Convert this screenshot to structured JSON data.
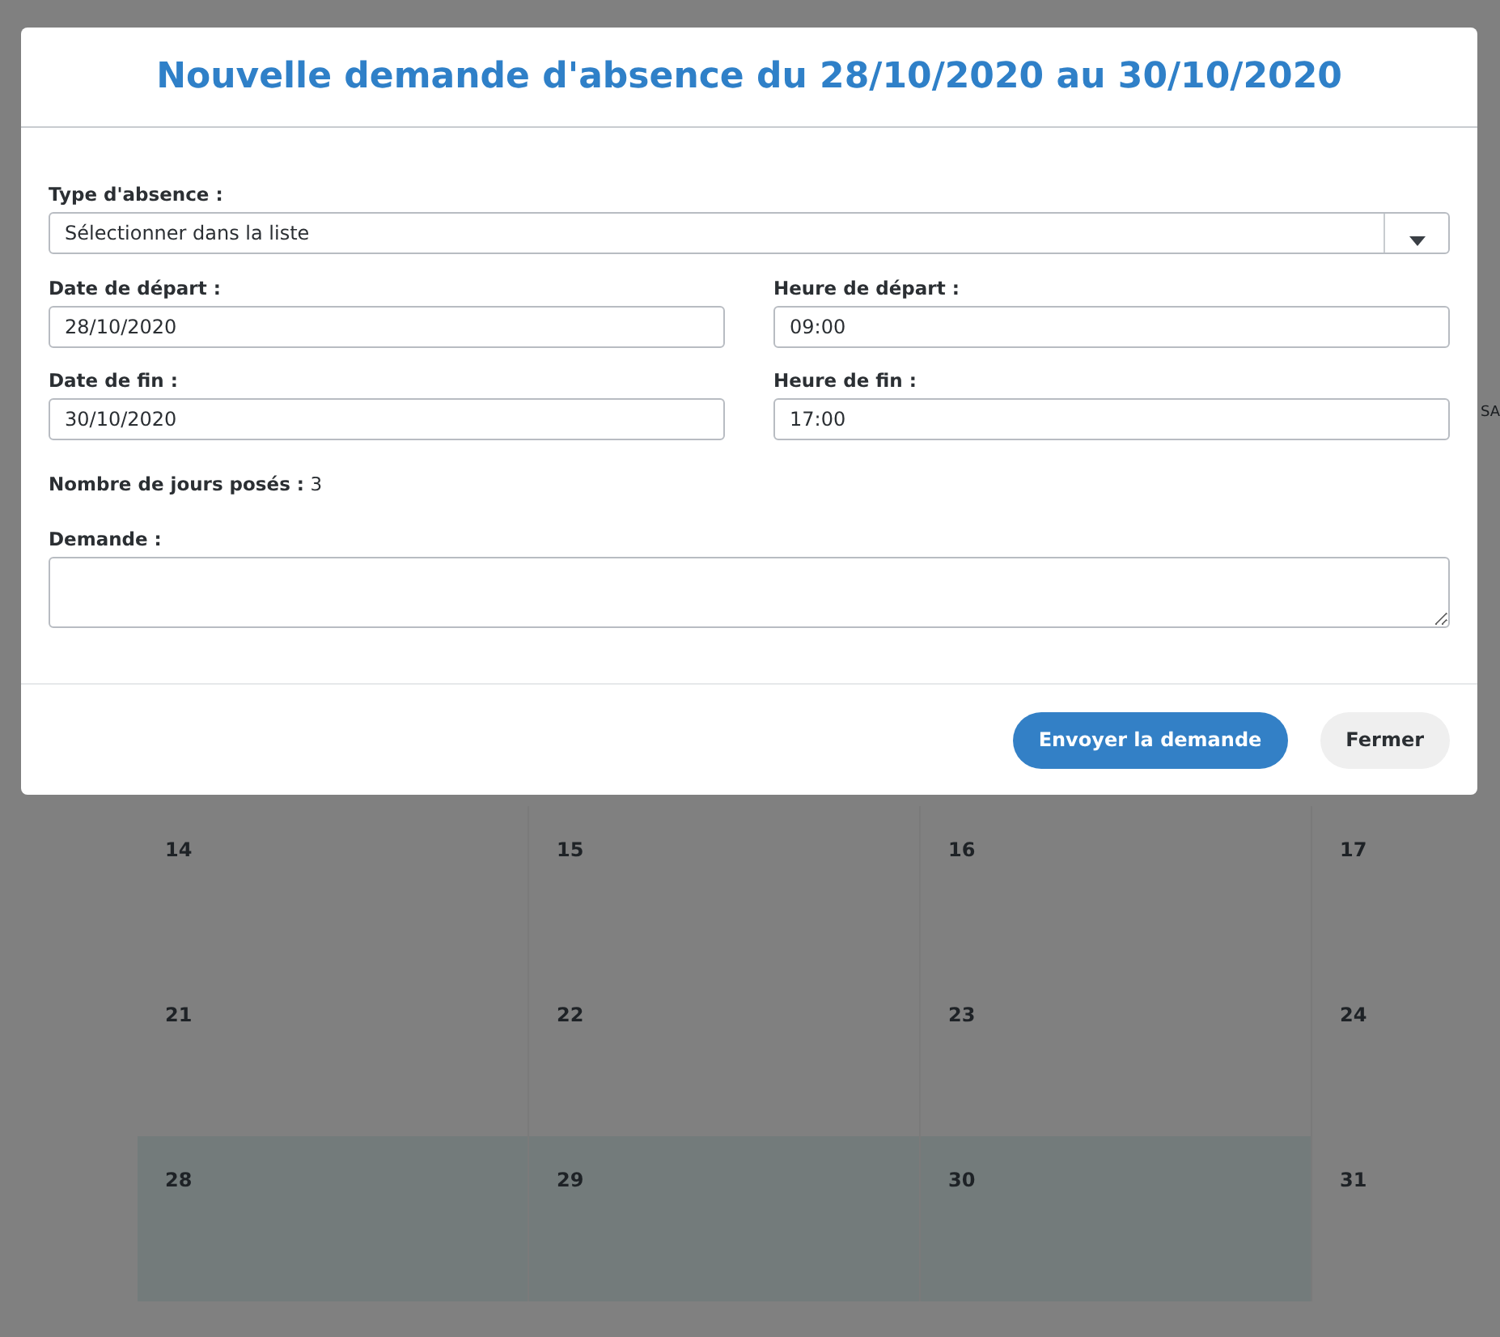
{
  "calendar": {
    "header_partial": "SA",
    "weeks": [
      {
        "days": [
          {
            "label": "14",
            "selected": false
          },
          {
            "label": "15",
            "selected": false
          },
          {
            "label": "16",
            "selected": false
          },
          {
            "label": "17",
            "selected": false
          }
        ]
      },
      {
        "days": [
          {
            "label": "21",
            "selected": false
          },
          {
            "label": "22",
            "selected": false
          },
          {
            "label": "23",
            "selected": false
          },
          {
            "label": "24",
            "selected": false
          }
        ]
      },
      {
        "days": [
          {
            "label": "28",
            "selected": true
          },
          {
            "label": "29",
            "selected": true
          },
          {
            "label": "30",
            "selected": true
          },
          {
            "label": "31",
            "selected": false
          }
        ]
      }
    ]
  },
  "dialog": {
    "title": "Nouvelle demande d'absence du 28/10/2020 au 30/10/2020",
    "type": {
      "label": "Type d'absence :",
      "value": "Sélectionner dans la liste"
    },
    "fields": [
      {
        "label": "Date de départ :",
        "value": "28/10/2020"
      },
      {
        "label": "Heure de départ :",
        "value": "09:00"
      },
      {
        "label": "Date de fin :",
        "value": "30/10/2020"
      },
      {
        "label": "Heure de fin :",
        "value": "17:00"
      }
    ],
    "days_count": {
      "label": "Nombre de jours posés :",
      "value": "3"
    },
    "request": {
      "label": "Demande :"
    },
    "buttons": [
      {
        "label": "Envoyer la demande",
        "kind": "primary"
      },
      {
        "label": "Fermer",
        "kind": "secondary"
      }
    ]
  }
}
